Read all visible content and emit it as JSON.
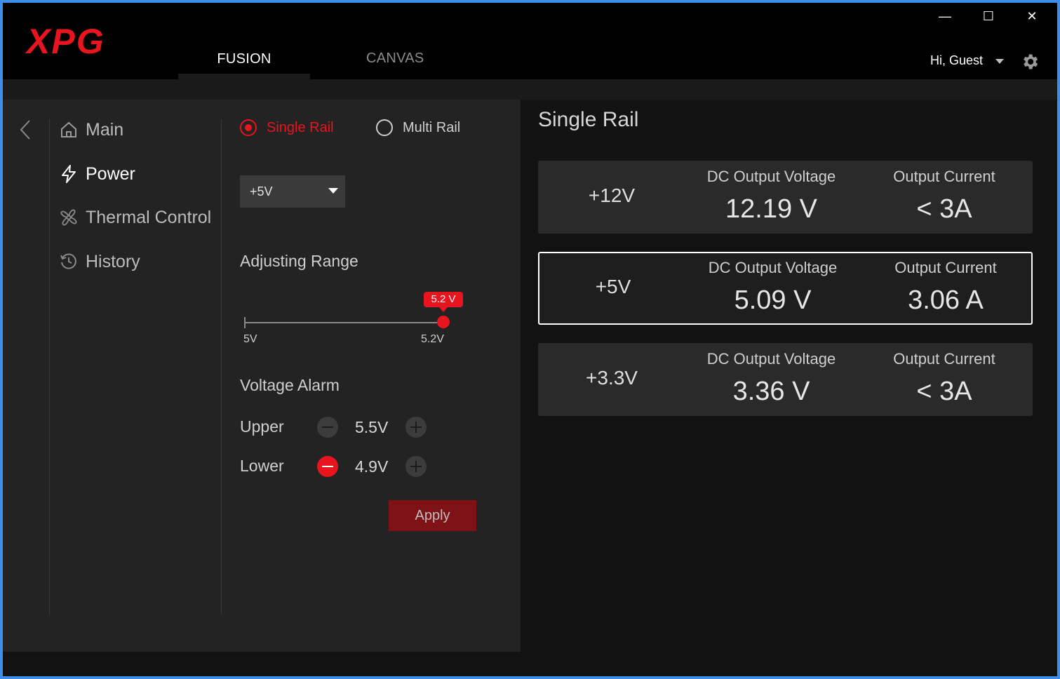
{
  "app": {
    "logo_text": "XPG",
    "tabs": [
      {
        "label": "FUSION",
        "active": true
      },
      {
        "label": "CANVAS",
        "active": false
      }
    ],
    "window_controls": {
      "minimize": "—",
      "maximize": "☐",
      "close": "✕"
    },
    "user_greeting": "Hi, Guest",
    "icons": {
      "settings": "gear-icon",
      "user_menu": "caret-down-icon",
      "back": "chevron-left-icon"
    }
  },
  "sidebar": {
    "items": [
      {
        "label": "Main",
        "icon": "home-icon",
        "active": false
      },
      {
        "label": "Power",
        "icon": "bolt-icon",
        "active": true
      },
      {
        "label": "Thermal Control",
        "icon": "fan-icon",
        "active": false
      },
      {
        "label": "History",
        "icon": "history-icon",
        "active": false
      }
    ]
  },
  "power": {
    "rail_modes": [
      {
        "label": "Single Rail",
        "selected": true
      },
      {
        "label": "Multi Rail",
        "selected": false
      }
    ],
    "rail_select": {
      "value": "+5V"
    },
    "adjusting_range": {
      "title": "Adjusting Range",
      "min_label": "5V",
      "max_label": "5.2V",
      "current_label": "5.2 V",
      "value_fraction": 1.0
    },
    "voltage_alarm": {
      "title": "Voltage Alarm",
      "upper": {
        "label": "Upper",
        "value": "5.5V"
      },
      "lower": {
        "label": "Lower",
        "value": "4.9V"
      }
    },
    "apply_label": "Apply"
  },
  "rails_panel": {
    "title": "Single Rail",
    "voltage_header": "DC Output Voltage",
    "current_header": "Output Current",
    "rails": [
      {
        "name": "+12V",
        "voltage": "12.19 V",
        "current": "< 3A",
        "selected": false
      },
      {
        "name": "+5V",
        "voltage": "5.09 V",
        "current": "3.06 A",
        "selected": true
      },
      {
        "name": "+3.3V",
        "voltage": "3.36 V",
        "current": "< 3A",
        "selected": false
      }
    ]
  },
  "colors": {
    "accent": "#e8141e",
    "apply_bg": "#7e1216",
    "window_border": "#3c8ee8"
  }
}
